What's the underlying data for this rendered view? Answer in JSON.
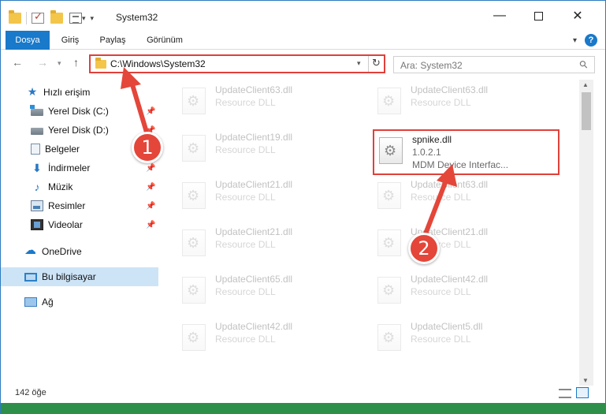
{
  "window": {
    "title": "System32",
    "accent": "#1979ca"
  },
  "quick_access_toolbar": [
    "folder-icon",
    "properties-check-icon",
    "new-folder-icon",
    "customize-icon"
  ],
  "ribbon": {
    "tabs": [
      {
        "label": "Dosya",
        "active": true
      },
      {
        "label": "Giriş"
      },
      {
        "label": "Paylaş"
      },
      {
        "label": "Görünüm"
      }
    ],
    "help_label": "?"
  },
  "address_bar": {
    "path": "C:\\Windows\\System32",
    "highlight_color": "#e0403a"
  },
  "search": {
    "placeholder": "Ara: System32"
  },
  "sidebar": {
    "items": [
      {
        "label": "Hızlı erişim",
        "icon": "star-icon"
      },
      {
        "label": "Yerel Disk (C:)",
        "icon": "drive-icon",
        "pinned": true
      },
      {
        "label": "Yerel Disk (D:)",
        "icon": "drive-icon",
        "pinned": true
      },
      {
        "label": "Belgeler",
        "icon": "documents-icon",
        "pinned": true
      },
      {
        "label": "İndirmeler",
        "icon": "download-icon",
        "pinned": true
      },
      {
        "label": "Müzik",
        "icon": "music-icon",
        "pinned": true
      },
      {
        "label": "Resimler",
        "icon": "pictures-icon",
        "pinned": true
      },
      {
        "label": "Videolar",
        "icon": "videos-icon",
        "pinned": true
      },
      {
        "label": "OneDrive",
        "icon": "onedrive-icon"
      },
      {
        "label": "Bu bilgisayar",
        "icon": "this-pc-icon",
        "selected": true
      },
      {
        "label": "Ağ",
        "icon": "network-icon"
      }
    ]
  },
  "files_left": [
    {
      "name": "UpdateClient63.dll",
      "desc": "Resource DLL"
    },
    {
      "name": "UpdateClient19.dll",
      "desc": "Resource DLL"
    },
    {
      "name": "UpdateClient21.dll",
      "desc": "Resource DLL"
    },
    {
      "name": "UpdateClient21.dll",
      "desc": "Resource DLL"
    },
    {
      "name": "UpdateClient65.dll",
      "desc": "Resource DLL"
    },
    {
      "name": "UpdateClient42.dll",
      "desc": "Resource DLL"
    }
  ],
  "files_right": [
    {
      "name": "UpdateClient63.dll",
      "desc": "Resource DLL"
    },
    {
      "name": "UpdateClient63.dll",
      "desc": "Resource DLL"
    },
    {
      "name": "UpdateClient21.dll",
      "desc": "Resource DLL"
    },
    {
      "name": "UpdateClient42.dll",
      "desc": "Resource DLL"
    },
    {
      "name": "UpdateClient5.dll",
      "desc": "Resource DLL"
    }
  ],
  "highlighted_file": {
    "name": "spnike.dll",
    "version": "1.0.2.1",
    "description": "MDM Device Interfac..."
  },
  "status": {
    "item_count": "142 öğe"
  },
  "annotations": {
    "badge1": "1",
    "badge2": "2",
    "color": "#e4463a"
  }
}
